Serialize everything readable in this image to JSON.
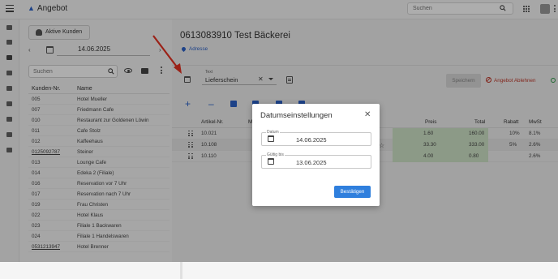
{
  "app": {
    "title": "Angebot",
    "search_placeholder": "Suchen"
  },
  "customers_panel": {
    "active_button": "Aktive Kunden",
    "date": "14.06.2025",
    "search_placeholder": "Suchen",
    "columns": {
      "number": "Kunden-Nr.",
      "name": "Name"
    },
    "rows": [
      {
        "number": "005",
        "name": "Hotel Mueller",
        "underlined": false
      },
      {
        "number": "007",
        "name": "Friedmann Cafe",
        "underlined": false
      },
      {
        "number": "010",
        "name": "Restaurant zur Goldenen Löwin",
        "underlined": false
      },
      {
        "number": "011",
        "name": "Cafe Stolz",
        "underlined": false
      },
      {
        "number": "012",
        "name": "Kaffeehaus",
        "underlined": false
      },
      {
        "number": "0125092787",
        "name": "Steiner",
        "underlined": true
      },
      {
        "number": "013",
        "name": "Lounge Cafe",
        "underlined": false
      },
      {
        "number": "014",
        "name": "Edeka 2 (Filiale)",
        "underlined": false
      },
      {
        "number": "016",
        "name": "Reservation vor 7 Uhr",
        "underlined": false
      },
      {
        "number": "017",
        "name": "Reservation nach 7 Uhr",
        "underlined": false
      },
      {
        "number": "019",
        "name": "Frau Christen",
        "underlined": false
      },
      {
        "number": "022",
        "name": "Hotel Klaus",
        "underlined": false
      },
      {
        "number": "023",
        "name": "Filiale 1 Backwaren",
        "underlined": false
      },
      {
        "number": "024",
        "name": "Filiale 1 Handelswaren",
        "underlined": false
      },
      {
        "number": "0531213947",
        "name": "Hotel Brenner",
        "underlined": true
      }
    ]
  },
  "offer": {
    "customer_title": "0613083910 Test Bäckerei",
    "address_link": "Adresse",
    "doc_type_label": "Text",
    "doc_type_value": "Lieferschein",
    "save_label": "Speichern",
    "reject_label": "Angebot Ablehnen",
    "columns": {
      "article": "Artikel-Nr.",
      "m": "M",
      "price": "Preis",
      "total": "Total",
      "discount": "Rabatt",
      "vat": "MwSt"
    },
    "items": [
      {
        "article": "10.021",
        "price": "1.60",
        "total": "160.00",
        "discount": "10%",
        "vat": "8.1%"
      },
      {
        "article": "10.108",
        "price": "33.30",
        "total": "333.00",
        "discount": "5%",
        "vat": "2.6%"
      },
      {
        "article": "10.110",
        "price": "4.00",
        "total": "0.80",
        "discount": "",
        "vat": "2.6%"
      }
    ]
  },
  "dialog": {
    "title": "Datumseinstellungen",
    "date_label": "Datum",
    "date_value": "14.06.2025",
    "valid_label": "Gültig bis",
    "valid_value": "13.06.2025",
    "confirm_label": "Bestätigen"
  },
  "colors": {
    "accent": "#2c62c9",
    "confirm": "#2f7fdd",
    "reject": "#c0392b",
    "highlight": "#cfe3c8",
    "annotation_arrow": "#e53222"
  },
  "icons": [
    "menu-icon",
    "cart-icon",
    "search-icon",
    "apps-icon",
    "avatar",
    "more-vert-icon",
    "person-icon",
    "calendar-icon",
    "eye-icon",
    "mail-icon",
    "document-icon",
    "check-circle-icon",
    "block-icon",
    "close-icon",
    "drag-handle-icon",
    "star-icon"
  ]
}
